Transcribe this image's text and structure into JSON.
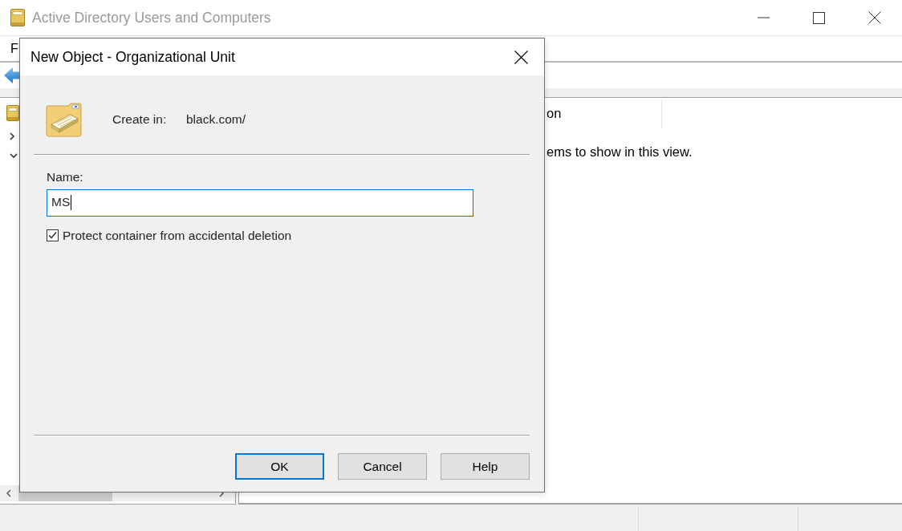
{
  "window": {
    "title": "Active Directory Users and Computers",
    "active": false
  },
  "menu": [
    "F"
  ],
  "tree": {
    "items": [
      {
        "expanded": false
      },
      {
        "expanded": true
      }
    ]
  },
  "list_view": {
    "columns": [
      "on"
    ],
    "empty_text": "ems to show in this view."
  },
  "dialog": {
    "title": "New Object - Organizational Unit",
    "create_in_label": "Create in:",
    "create_in_value": "black.com/",
    "name_label": "Name:",
    "name_field": {
      "value": "MS",
      "focused": true
    },
    "protect_checkbox": {
      "label": "Protect container from accidental deletion",
      "checked": true
    },
    "buttons": [
      {
        "label": "OK",
        "default": true
      },
      {
        "label": "Cancel",
        "default": false
      },
      {
        "label": "Help",
        "default": false
      }
    ]
  }
}
